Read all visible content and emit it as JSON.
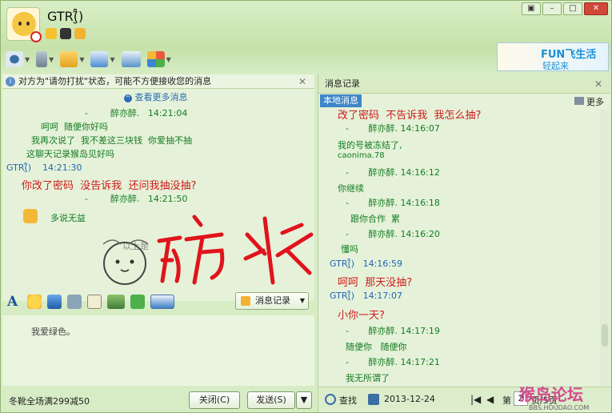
{
  "window": {
    "title": "GTR(̮̑̑)"
  },
  "toolbar": {
    "icons": [
      "video-icon",
      "mic-icon",
      "file-transfer-icon",
      "remote-desktop-icon",
      "screen-share-icon",
      "apps-icon"
    ]
  },
  "ad": {
    "line1": "FUN飞生活",
    "line2": "轻起来"
  },
  "notice": {
    "text": "对方为\"请勿打扰\"状态，可能不方便接收您的消息"
  },
  "chat": {
    "more_link": "查看更多消息",
    "messages": [
      {
        "text": "-        醉亦醉.   14:21:04",
        "style": "g"
      },
      {
        "text": "呵呵  随便你好吗",
        "style": "g"
      },
      {
        "text": "我再次说了  我不差这三块钱  你爱抽不抽",
        "style": "g"
      },
      {
        "text": "这聊天记录猴岛见好吗",
        "style": "g"
      },
      {
        "text": "GTR(̮̑̑)    14:21:30",
        "style": "b"
      },
      {
        "text": "你改了密码  没告诉我  还问我抽没抽?",
        "style": "r"
      },
      {
        "text": "-        醉亦醉.   14:21:50",
        "style": "g"
      },
      {
        "text": "多说无益",
        "style": "g"
      }
    ],
    "hint": "以上是"
  },
  "graffiti_text": "防水",
  "history_button": "消息记录",
  "input_text": "我爱绿色。",
  "bottom": {
    "ticker": "冬靴全场满299减50",
    "close": "关闭(C)",
    "send": "发送(S)"
  },
  "right": {
    "title": "消息记录",
    "tab": "本地消息",
    "more": "更多",
    "entries": [
      {
        "text": "改了密码  不告诉我  我怎么抽?",
        "style": "r"
      },
      {
        "text": "-       醉亦醉. 14:16:07",
        "style": "g"
      },
      {
        "text": "我的号被冻结了,",
        "style": "g"
      },
      {
        "text": "caonima.78",
        "style": "g"
      },
      {
        "text": "-       醉亦醉. 14:16:12",
        "style": "g"
      },
      {
        "text": "你继续",
        "style": "g"
      },
      {
        "text": "-       醉亦醉. 14:16:18",
        "style": "g"
      },
      {
        "text": "跟你合作  累",
        "style": "g"
      },
      {
        "text": "-       醉亦醉. 14:16:20",
        "style": "g"
      },
      {
        "text": "懂吗",
        "style": "g"
      },
      {
        "text": "GTR(̮̑̑)   14:16:59",
        "style": "b"
      },
      {
        "text": "呵呵  那天没抽?",
        "style": "r"
      },
      {
        "text": "GTR(̮̑̑)   14:17:07",
        "style": "b"
      },
      {
        "text": "小你一天?",
        "style": "r"
      },
      {
        "text": "-       醉亦醉. 14:17:19",
        "style": "g"
      },
      {
        "text": "随便你   随便你",
        "style": "g"
      },
      {
        "text": "-       醉亦醉. 14:17:21",
        "style": "g"
      },
      {
        "text": "我无所谓了",
        "style": "g"
      }
    ],
    "footer": {
      "search": "查找",
      "date": "2013-12-24",
      "page_label": "第",
      "page": "2",
      "page_suffix": "页/5页"
    }
  },
  "watermark": {
    "main": "猴岛论坛",
    "sub": "BBS.HOUDAO.COM"
  },
  "colors": {
    "green_text": "#147c22",
    "blue_text": "#2067b5",
    "red_text": "#d01b1b",
    "accent": "#3e86c8"
  }
}
